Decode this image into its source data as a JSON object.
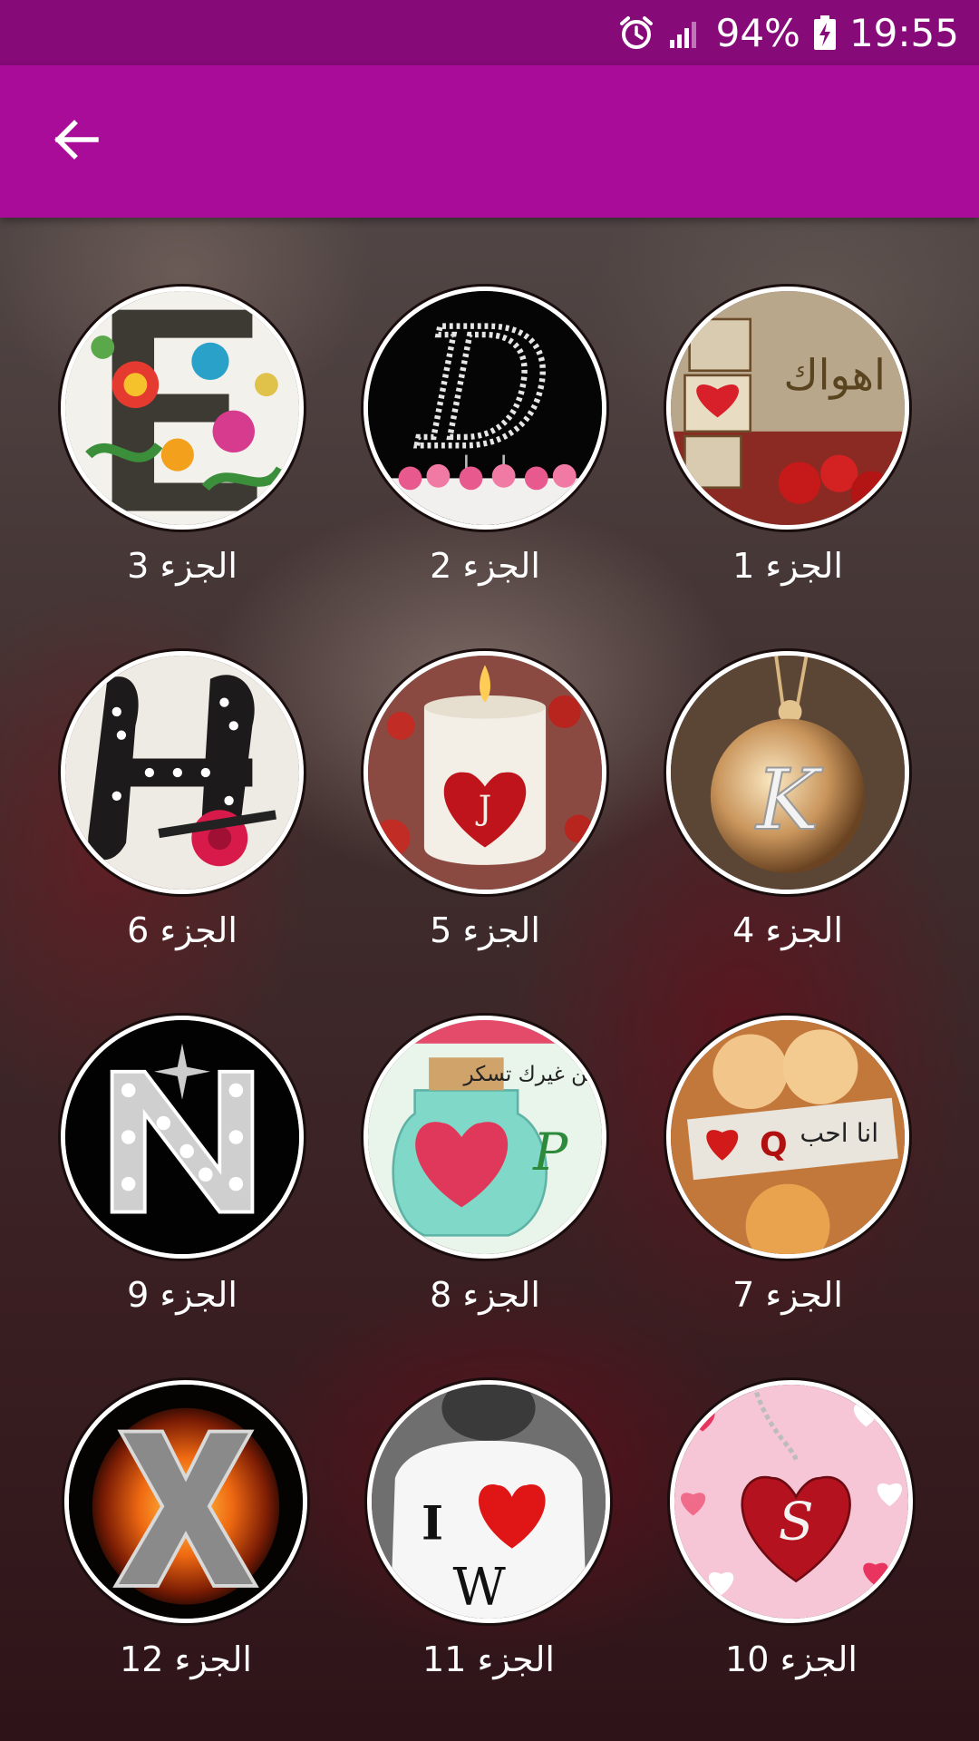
{
  "status_bar": {
    "battery": "94%",
    "time": "19:55",
    "icons": [
      "alarm-icon",
      "signal-icon",
      "battery-charging-icon"
    ]
  },
  "app_bar": {
    "back_icon": "arrow-back-icon"
  },
  "grid": {
    "items": [
      {
        "label": "الجزء 1",
        "image": "letter-A-blocks-heart"
      },
      {
        "label": "الجزء 2",
        "image": "letter-D-crystal-cake"
      },
      {
        "label": "الجزء 3",
        "image": "letter-E-embroidery"
      },
      {
        "label": "الجزء 4",
        "image": "letter-K-locket"
      },
      {
        "label": "الجزء 5",
        "image": "letter-J-candle-heart"
      },
      {
        "label": "الجزء 6",
        "image": "letter-H-dotted-flower"
      },
      {
        "label": "الجزء 7",
        "image": "letter-Q-sign"
      },
      {
        "label": "الجزء 8",
        "image": "letter-P-jar-heart"
      },
      {
        "label": "الجزء 9",
        "image": "letter-N-diamonds"
      },
      {
        "label": "الجزء 10",
        "image": "letter-S-heart-pendant"
      },
      {
        "label": "الجزء 11",
        "image": "letter-W-i-love-shirt"
      },
      {
        "label": "الجزء 12",
        "image": "letter-X-fire"
      }
    ]
  },
  "colors": {
    "status_bar": "#860a78",
    "app_bar": "#a80c98",
    "text": "#ffffff"
  }
}
